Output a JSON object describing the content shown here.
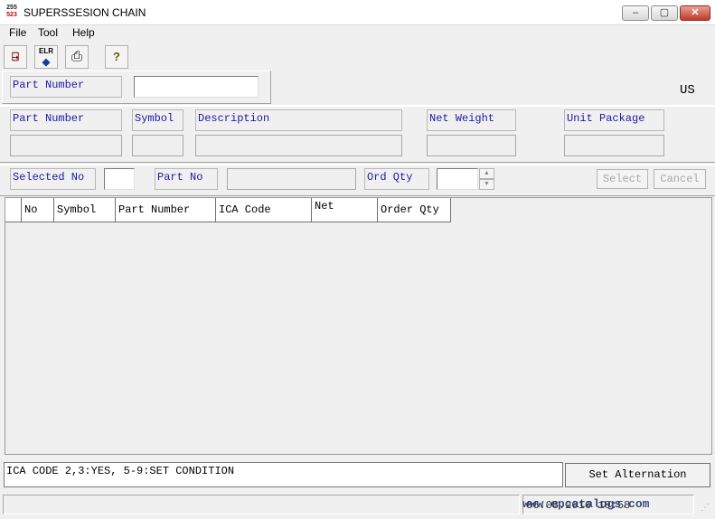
{
  "window": {
    "title": "SUPERSSESION CHAIN",
    "icon_top": "255",
    "icon_bottom": "523",
    "controls": {
      "minimize": "‒",
      "maximize": "▢",
      "close": "✕"
    }
  },
  "menu": [
    "File",
    "Tool",
    "Help"
  ],
  "toolbar": [
    {
      "icon": "book-exit-icon",
      "glyph": "⍈"
    },
    {
      "icon": "eraser-clear-icon",
      "glyph": "ELR"
    },
    {
      "icon": "printer-icon",
      "glyph": "⎙"
    },
    {
      "icon": "help-bulb-icon",
      "glyph": "?"
    }
  ],
  "search": {
    "label": "Part Number",
    "value": "",
    "region": "US"
  },
  "detail": {
    "part_number_label": "Part Number",
    "symbol_label": "Symbol",
    "description_label": "Description",
    "net_weight_label": "Net Weight",
    "unit_package_label": "Unit Package",
    "part_number_value": "",
    "symbol_value": "",
    "description_value": "",
    "net_weight_value": "",
    "unit_package_value": ""
  },
  "selection": {
    "selected_no_label": "Selected No",
    "selected_no_value": "",
    "part_no_label": "Part No",
    "part_no_value": "",
    "ord_qty_label": "Ord Qty",
    "ord_qty_value": "",
    "select_button": "Select",
    "cancel_button": "Cancel"
  },
  "grid": {
    "columns": [
      "No",
      "Symbol",
      "Part Number",
      "ICA Code",
      "Net",
      "Order Qty"
    ],
    "rows": []
  },
  "footer": {
    "ica_note": "ICA CODE 2,3:YES, 5-9:SET CONDITION",
    "set_alternation_button": "Set Alternation",
    "status_time": "06.08.2016 10:58",
    "watermark": "www.epcatalogs.com"
  },
  "colors": {
    "label_text": "#1a1aa6",
    "window_bg": "#f0f0f0",
    "close_button": "#c0392b"
  }
}
